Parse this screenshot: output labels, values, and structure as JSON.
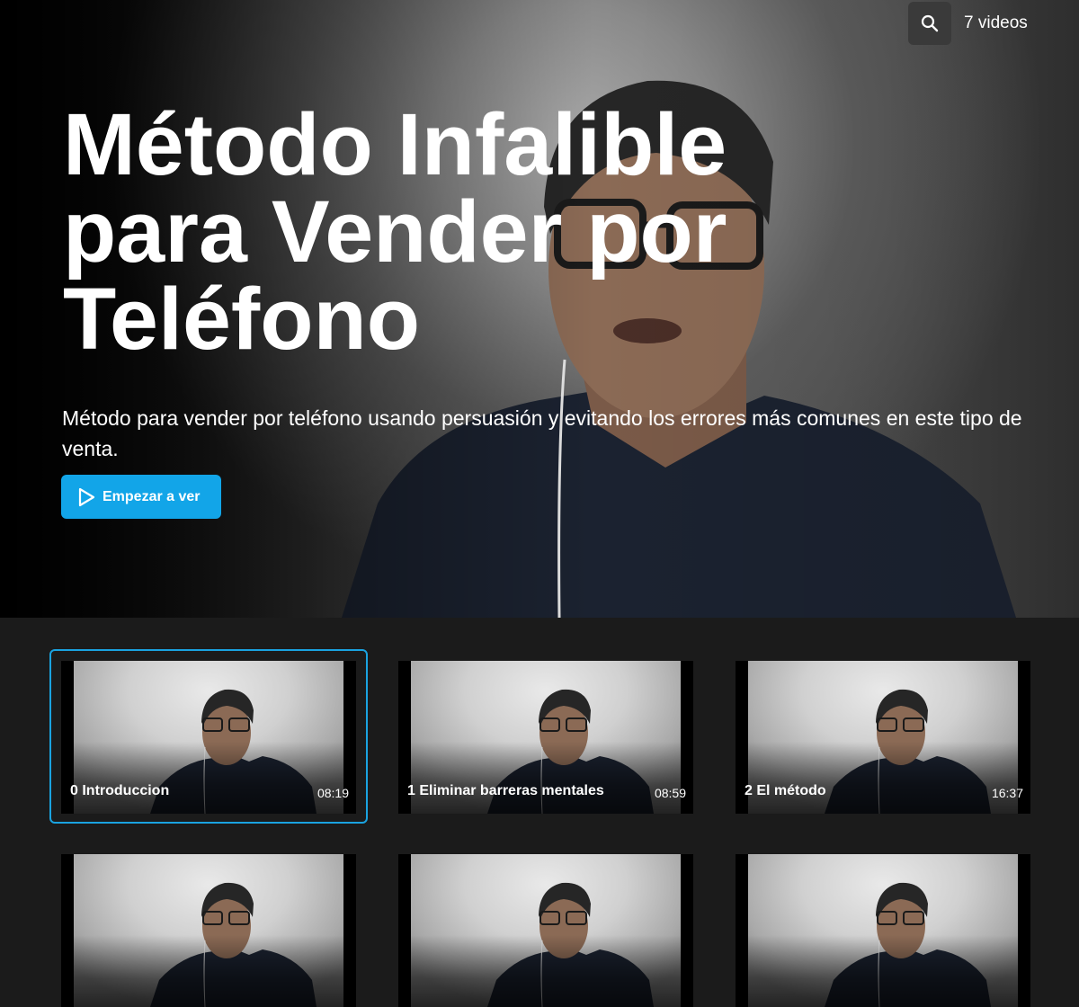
{
  "header": {
    "search_icon": "search-icon",
    "video_count": "7 videos"
  },
  "hero": {
    "title": "Método Infalible para Vender por Teléfono",
    "description": "Método para vender por teléfono usando persuasión y evitando los errores más comunes en este tipo de venta.",
    "cta_label": "Empezar a ver",
    "cta_icon": "play-icon",
    "accent_color": "#12a5e8"
  },
  "videos": [
    {
      "title": "0 Introduccion",
      "duration": "08:19",
      "selected": true
    },
    {
      "title": "1 Eliminar barreras mentales",
      "duration": "08:59",
      "selected": false
    },
    {
      "title": "2 El método",
      "duration": "16:37",
      "selected": false
    },
    {
      "title": "",
      "duration": "",
      "selected": false
    },
    {
      "title": "",
      "duration": "",
      "selected": false
    },
    {
      "title": "",
      "duration": "",
      "selected": false
    }
  ]
}
